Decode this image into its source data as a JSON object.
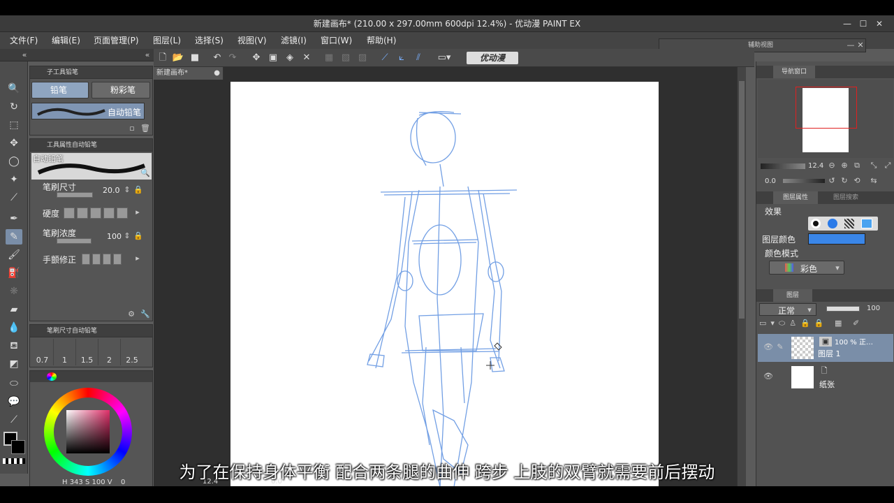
{
  "window": {
    "title": "新建画布* (210.00 x 297.00mm 600dpi 12.4%)  - 优动漫 PAINT EX",
    "min": "—",
    "max": "☐",
    "close": "✕"
  },
  "menu": [
    "文件(F)",
    "编辑(E)",
    "页面管理(P)",
    "图层(L)",
    "选择(S)",
    "视图(V)",
    "滤镜(I)",
    "窗口(W)",
    "帮助(H)"
  ],
  "subview": {
    "title": "辅助视图"
  },
  "toolbar": {
    "logo": "优动漫"
  },
  "doc_tab": "新建画布*",
  "sub_tool_panel": {
    "title": "子工具铅笔",
    "tab_pencil": "铅笔",
    "tab_pastel": "粉彩笔",
    "brush_name": "自动铅笔"
  },
  "tool_property": {
    "title": "工具属性自动铅笔",
    "brush_name": "自动铅笔",
    "size_label": "笔刷尺寸",
    "size_value": "20.0",
    "hardness_label": "硬度",
    "density_label": "笔刷浓度",
    "density_value": "100",
    "stabilizer_label": "手颤修正"
  },
  "brush_size_panel": {
    "title": "笔刷尺寸自动铅笔",
    "sizes": [
      "0.7",
      "1",
      "1.5",
      "2",
      "2.5"
    ]
  },
  "color": {
    "hsv": "H 343 S 100 V",
    "extra": "0",
    "fg": "#000000",
    "bg": "#ffffff"
  },
  "navigator": {
    "title": "导航窗口",
    "zoom": "12.4",
    "rotate": "0.0"
  },
  "layer_property": {
    "tab1": "图层属性",
    "tab2": "图层搜索",
    "effect_label": "效果",
    "layer_color_label": "图层颜色",
    "layer_color": "#3a86e8",
    "color_mode_label": "颜色模式",
    "color_mode_value": "彩色"
  },
  "layers": {
    "tab": "图层",
    "blend": "正常",
    "opacity": "100",
    "items": [
      {
        "name": "图层 1",
        "info": "100 % 正…"
      },
      {
        "name": "纸张",
        "info": ""
      }
    ]
  },
  "status": {
    "zoom": "12.4",
    "angle": "0.0"
  },
  "subtitle": "为了在保持身体平衡 配合两条腿的曲伸 跨步 上肢的双臂就需要前后摆动"
}
